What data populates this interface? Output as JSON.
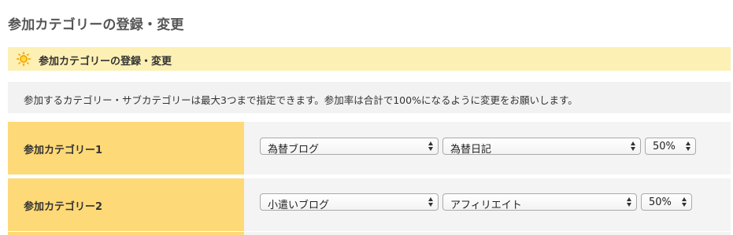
{
  "page_title": "参加カテゴリーの登録・変更",
  "section": {
    "title": "参加カテゴリーの登録・変更",
    "icon": "sun-icon"
  },
  "info_text": "参加するカテゴリー・サブカテゴリーは最大3つまで指定できます。参加率は合計で100%になるように変更をお願いします。",
  "rows": [
    {
      "label": "参加カテゴリー1",
      "category": "為替ブログ",
      "subcategory": "為替日記",
      "rate": "50%"
    },
    {
      "label": "参加カテゴリー2",
      "category": "小遣いブログ",
      "subcategory": "アフィリエイト",
      "rate": "50%"
    }
  ],
  "colors": {
    "header_bg": "#fdf0b4",
    "row_head_bg": "#fed977",
    "row_body_bg": "#f4f4f4",
    "sun_icon": "#f5a800"
  }
}
